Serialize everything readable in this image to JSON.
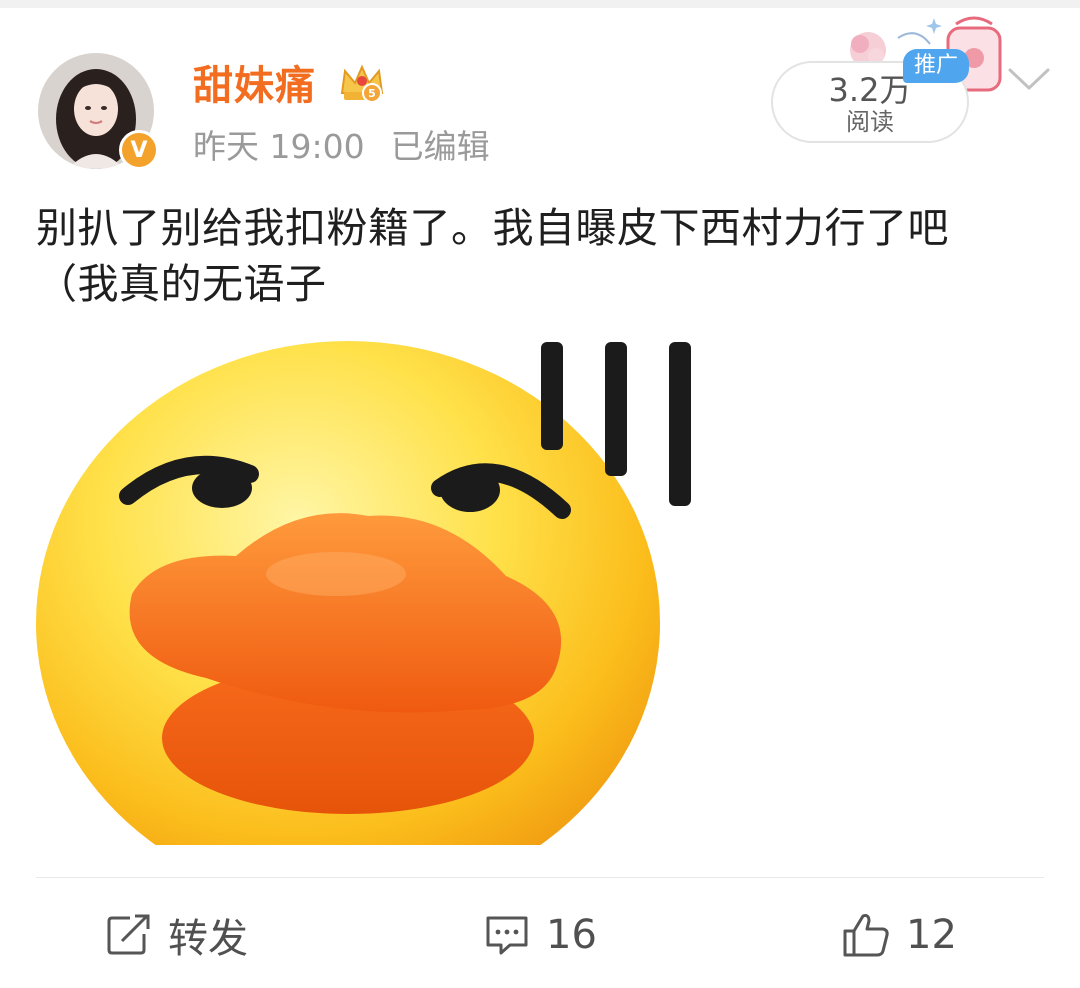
{
  "post": {
    "username": "甜妹痛",
    "level": "5",
    "verified_mark": "V",
    "time": "昨天 19:00",
    "edited": "已编辑",
    "text_line1": "别扒了别给我扣粉籍了。我自曝皮下西村力行了吧",
    "text_line2": "（我真的无语子"
  },
  "reads": {
    "count": "3.2万",
    "label": "阅读",
    "promo_badge": "推广"
  },
  "actions": {
    "repost_label": "转发",
    "comments": "16",
    "likes": "12"
  },
  "icons": {
    "avatar": "user-avatar",
    "verified": "verified-badge-icon",
    "crown": "crown-level-icon",
    "menu": "chevron-down-icon",
    "repost": "repost-icon",
    "comment": "comment-icon",
    "like": "thumbs-up-icon"
  },
  "colors": {
    "username": "#f26d20",
    "meta_text": "#9a9a9a",
    "promo_badge": "#4fa6ef",
    "verified_badge": "#f3a22c",
    "action_text": "#505050"
  }
}
